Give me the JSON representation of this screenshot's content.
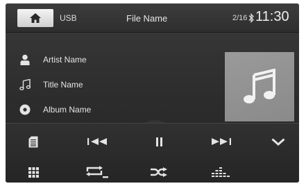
{
  "header": {
    "home_icon": "home-icon",
    "source": "USB",
    "title": "File Name",
    "track_counter": "2/16",
    "bluetooth_icon": "bluetooth-icon",
    "time": "11:30"
  },
  "track_info": {
    "artist": "Artist Name",
    "title": "Title Name",
    "album": "Album Name",
    "artist_icon": "person-icon",
    "title_icon": "music-note-icon",
    "album_icon": "disc-icon",
    "album_art_icon": "music-note-icon"
  },
  "controls": {
    "row1": [
      "file-list-icon",
      "previous-track-icon",
      "pause-icon",
      "next-track-icon",
      "chevron-down-icon"
    ],
    "row2": [
      "menu-grid-icon",
      "repeat-icon",
      "shuffle-icon",
      "equalizer-icon"
    ]
  },
  "colors": {
    "background": "#2c2c2c",
    "text": "#e4e4e4",
    "album_art": "#8f8f8f",
    "home_button": "#e6e6e6"
  }
}
